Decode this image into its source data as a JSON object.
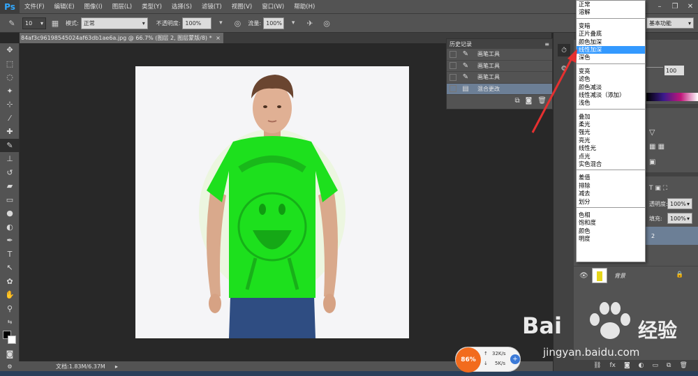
{
  "app": {
    "logo": "Ps"
  },
  "menubar": {
    "items": [
      "文件(F)",
      "编辑(E)",
      "图像(I)",
      "图层(L)",
      "类型(Y)",
      "选择(S)",
      "滤镜(T)",
      "视图(V)",
      "窗口(W)",
      "帮助(H)"
    ]
  },
  "options": {
    "brush_size": "10",
    "mode_label": "模式:",
    "mode_value": "正常",
    "opacity_label": "不透明度:",
    "opacity_value": "100%",
    "flow_label": "流量:",
    "flow_value": "100%",
    "workspace": "基本功能"
  },
  "document": {
    "tab_title": "84af3c96198545024af63db1ae6a.jpg @ 66.7% (图层 2, 图层蒙版/8) *",
    "close": "×"
  },
  "status": {
    "doc_size": "文档:1.83M/6.37M"
  },
  "history": {
    "title": "历史记录",
    "items": [
      {
        "label": "画笔工具"
      },
      {
        "label": "画笔工具"
      },
      {
        "label": "画笔工具"
      },
      {
        "label": "混合更改"
      }
    ]
  },
  "blend_menu": {
    "groups": [
      [
        "正常",
        "溶解"
      ],
      [
        "变暗",
        "正片叠底",
        "颜色加深",
        "线性加深",
        "深色"
      ],
      [
        "变亮",
        "滤色",
        "颜色减淡",
        "线性减淡（添加）",
        "浅色"
      ],
      [
        "叠加",
        "柔光",
        "强光",
        "亮光",
        "线性光",
        "点光",
        "实色混合"
      ],
      [
        "差值",
        "排除",
        "减去",
        "划分"
      ],
      [
        "色相",
        "饱和度",
        "颜色",
        "明度"
      ]
    ],
    "selected": "线性加深"
  },
  "right_panels": {
    "opacity_value_top": "100",
    "layer_opacity_label": "透明度:",
    "layer_opacity_value": "100%",
    "fill_label": "填充:",
    "fill_value": "100%",
    "layer2_suffix": "2",
    "background_layer": "背景"
  },
  "overlay": {
    "speed_pct": "86%",
    "up_speed": "32K/s",
    "down_speed": "5K/s",
    "watermark_brand": "Bai",
    "watermark_cn": "经验",
    "watermark_url": "jingyan.baidu.com"
  },
  "colors": {
    "shirt_green": "#1de01d",
    "selection_blue": "#3399ff",
    "history_selected": "#6c7f96",
    "speed_orange": "#f26b1d"
  }
}
